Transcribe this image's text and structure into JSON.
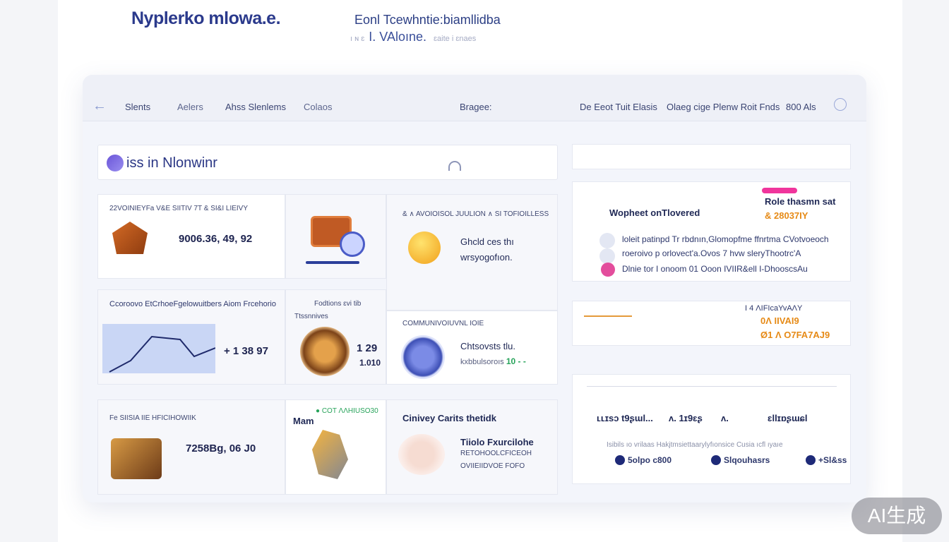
{
  "header": {
    "brand": "Nyplerko mlowa.e.",
    "title": "Eonl Tcewhntie:biamllidba",
    "subtitle_prefix": "ı ɴ ɛ",
    "subtitle": "I. VAloıne.",
    "subtitle_suffix": "ɛaite i ɛnaes"
  },
  "nav": {
    "items": [
      "Slents",
      "Aelers",
      "Ahss Slenlems",
      "Colaos"
    ],
    "center": "Bragee:",
    "right": [
      "De Eeot Tuit Elasis",
      "Olaeg cige Plenw Roit Fnds",
      "800 Als"
    ]
  },
  "search": {
    "placeholder": "iss in Nlonwinr"
  },
  "cards": {
    "c1": {
      "label": "22VOINIEYFa V&E SIITIV 7T & SI&I LIEIVY",
      "value": "9006.36, 49, 92"
    },
    "c2": {
      "label": "& ∧ AVOIOISOL JUULION ∧ SI TOFIOILLESS",
      "text1": "Ghcld ces thı",
      "text2": "wrsyogofıon."
    },
    "c3": {
      "label": "Ccoroovo EtCrhoeFgelowuitbers Aiom Frcehorio",
      "value": "+ 1 38 97"
    },
    "c4": {
      "label": "Fodtions ɛvi tib",
      "sub": "Ttssnnives",
      "value1": "1 29",
      "value2": "1.010"
    },
    "c5": {
      "label": "COMMUNIVOIUVNL IOIE",
      "text1": "Chtsovsts tlu.",
      "text2": "kxbbulsoroıs",
      "text2_suffix": "10 - -"
    },
    "c6": {
      "label": "Fe SIISIA IIE HFICIHOWIIK",
      "value": "7258Bg, 06 J0"
    },
    "c7": {
      "label": "● COT ΛΛΗΙUSO30",
      "sub": "Mam"
    },
    "c8": {
      "label": "Cinivey Carits thetidk",
      "text1": "Tiiolo Fxurcilohe",
      "text2": "RETOHOOLCFICEOH",
      "text3": "OVIIEIIDVOE FOFO"
    }
  },
  "right_panel": {
    "card1": {
      "title": "Wopheet onTlovered",
      "tag1": "Role thasmn sat",
      "tag2": "& 28037IY",
      "rows": [
        "loleit patinpd Tr rbdnın,Glomopfme ffnrtma CVotvoeoch",
        "roeroivo p orlovect'a.Ovos    7 hvw sleryThootrc'A",
        "Dlnie tor   I onoom 01 Ooon    IVIIR&ell I-DhooscsAu"
      ]
    },
    "card2": {
      "line1": "I 4 ΛIFIcaYvAΛY",
      "line2": "0Λ IIVAI9",
      "line3": "Ø1 Λ O7FA7AJ9"
    },
    "card3": {
      "row1": [
        "ʟʟɪsɔ t9ʂɯl...",
        "ʌ. 1ɪ9ɛʂ",
        "ʌ.",
        "ɛllɪɒʂɯɕl"
      ],
      "row2": "Isibils ıo vrilaas    Hakjtmsiettaarylyfıonsice   Cusia ıcfl ıyaıe",
      "row3": [
        "5olpo c800",
        "Slqouhasrs",
        "+Sl&ss"
      ]
    }
  },
  "watermark": "AI生成"
}
